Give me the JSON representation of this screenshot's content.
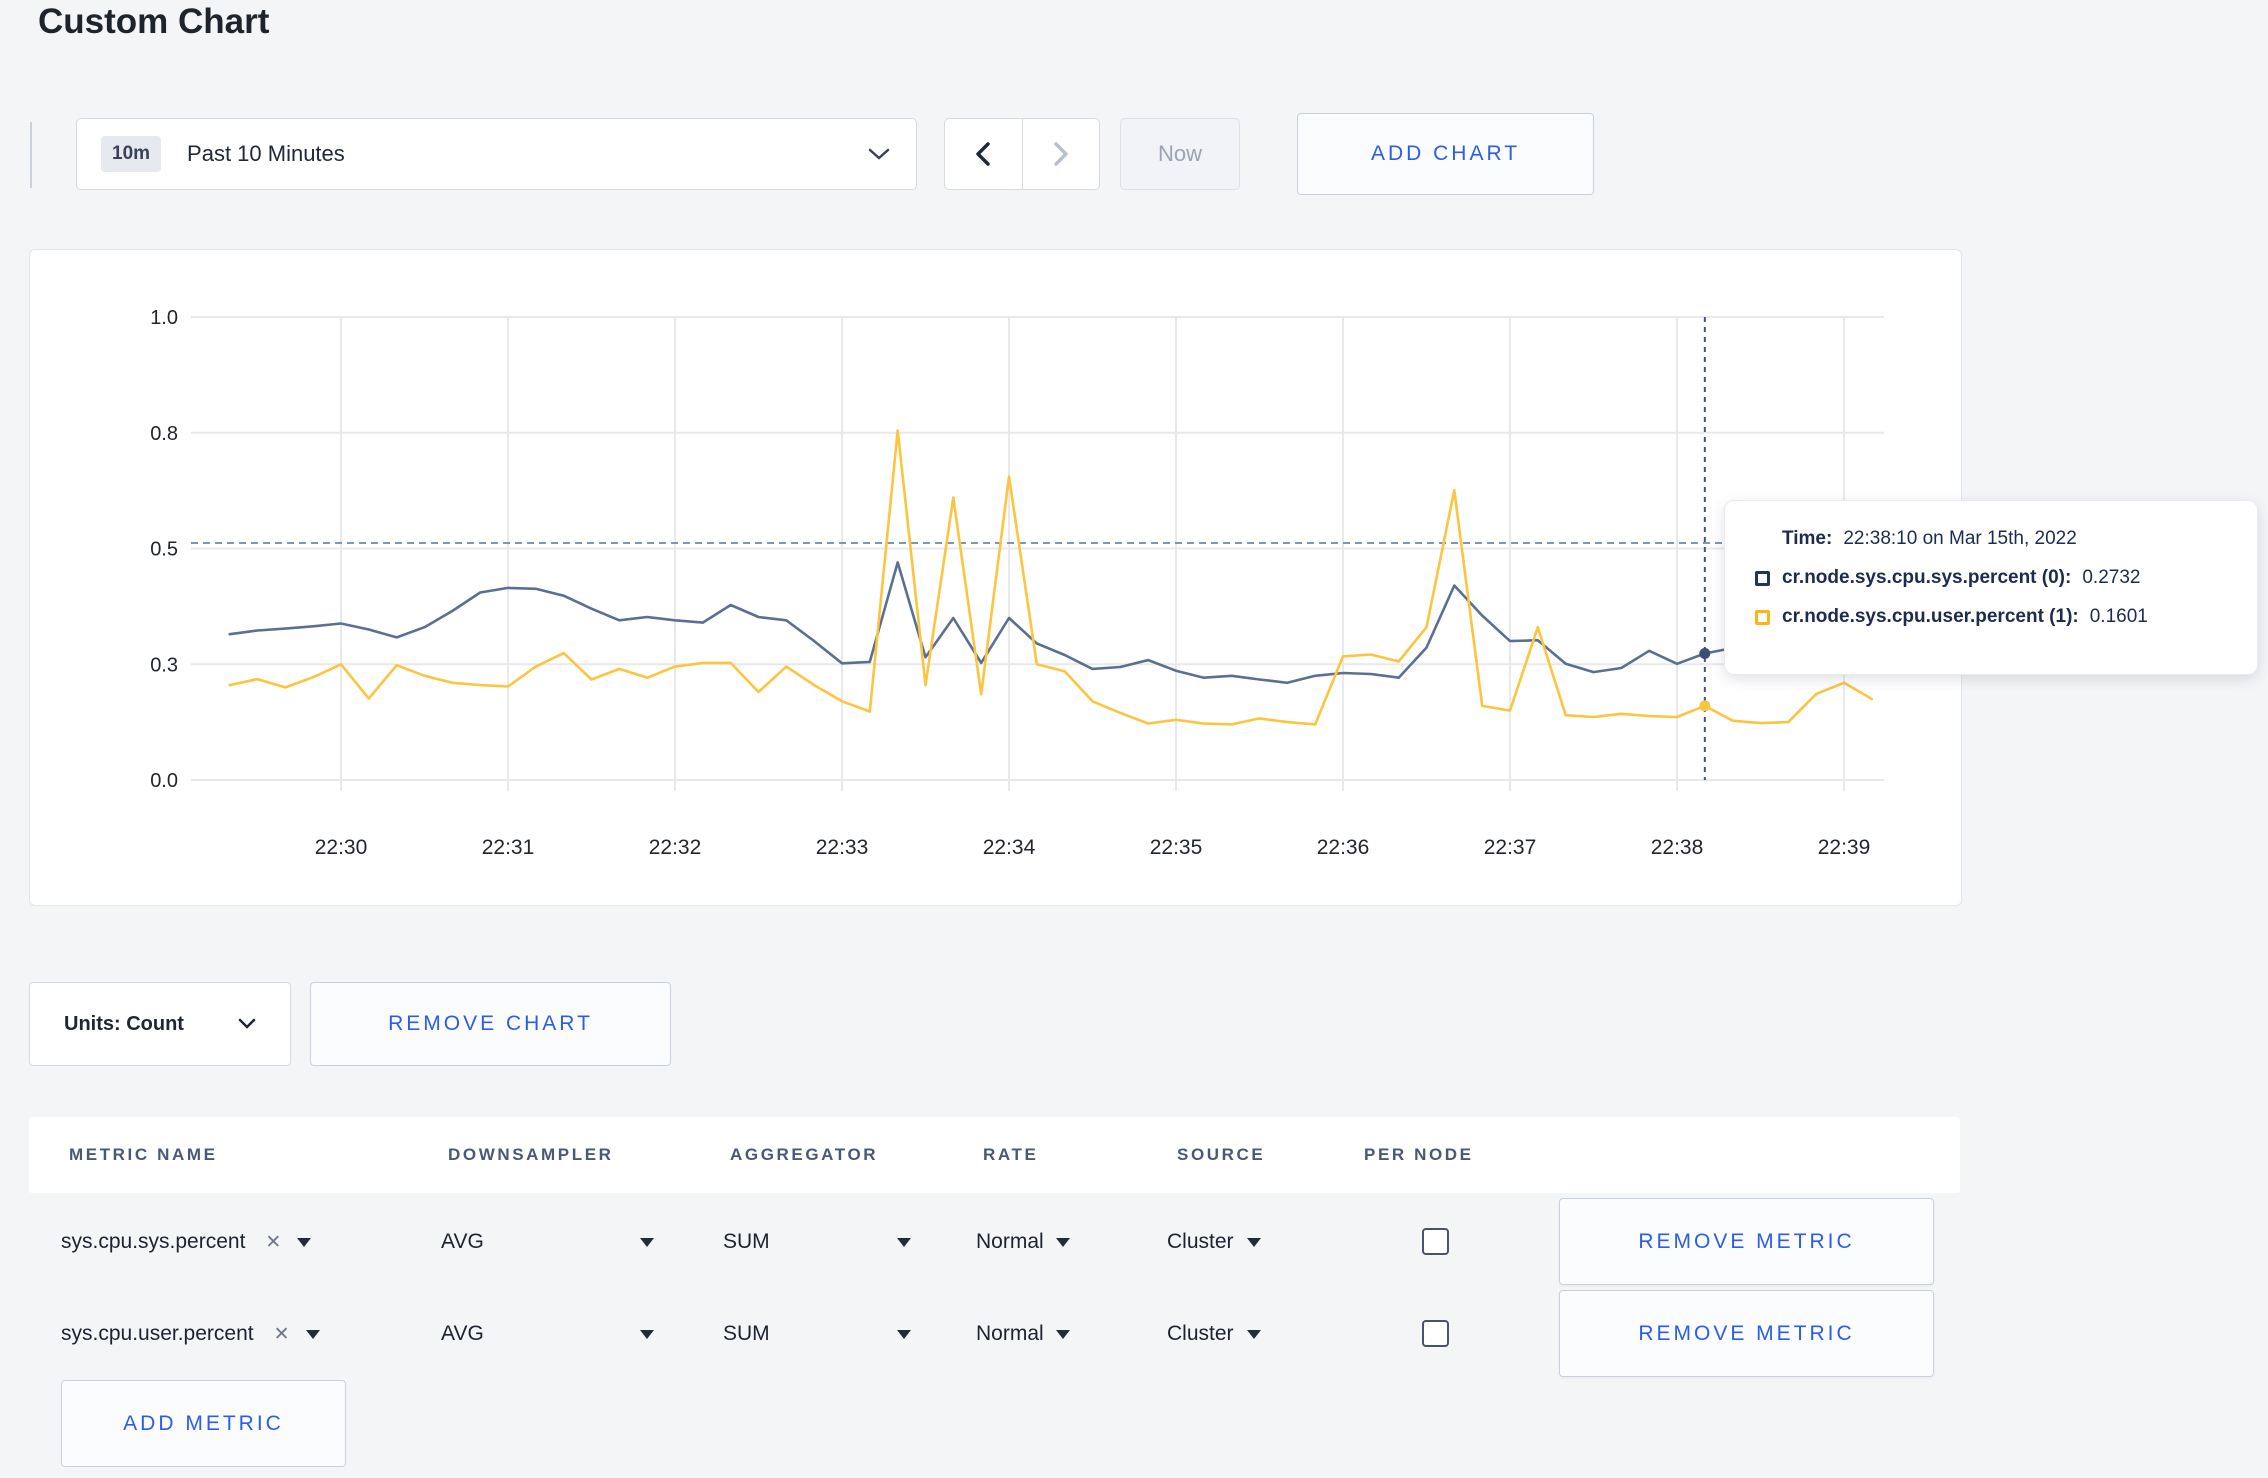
{
  "page": {
    "title": "Custom Chart",
    "background": "#f4f5f7"
  },
  "toolbar": {
    "time_window_badge": "10m",
    "time_window_label": "Past 10 Minutes",
    "prev_icon": "chevron-left",
    "next_icon": "chevron-right",
    "now_label": "Now",
    "add_chart_label": "ADD CHART"
  },
  "chart_controls": {
    "units_label": "Units: Count",
    "remove_chart_label": "REMOVE CHART"
  },
  "tooltip": {
    "time_label": "Time:",
    "time_value": "22:38:10 on Mar 15th, 2022",
    "series": [
      {
        "name": "cr.node.sys.cpu.sys.percent (0):",
        "value": "0.2732",
        "color": "#24335b"
      },
      {
        "name": "cr.node.sys.cpu.user.percent (1):",
        "value": "0.1601",
        "color": "#fdb515"
      }
    ]
  },
  "chart_data": {
    "type": "line",
    "title": "",
    "xlabel": "",
    "ylabel": "",
    "grid": true,
    "legend_position": "tooltip-only",
    "ylim": [
      0,
      1.045
    ],
    "y_ticks": [
      {
        "label": "0.0",
        "value": 0
      },
      {
        "label": "0.3",
        "value": 0.25
      },
      {
        "label": "0.5",
        "value": 0.5
      },
      {
        "label": "0.8",
        "value": 0.75
      },
      {
        "label": "1.0",
        "value": 1.0
      }
    ],
    "x_ticks": [
      {
        "label": "22:30",
        "seconds": 0
      },
      {
        "label": "22:31",
        "seconds": 60
      },
      {
        "label": "22:32",
        "seconds": 120
      },
      {
        "label": "22:33",
        "seconds": 180
      },
      {
        "label": "22:34",
        "seconds": 240
      },
      {
        "label": "22:35",
        "seconds": 300
      },
      {
        "label": "22:36",
        "seconds": 360
      },
      {
        "label": "22:37",
        "seconds": 420
      },
      {
        "label": "22:38",
        "seconds": 480
      },
      {
        "label": "22:39",
        "seconds": 540
      }
    ],
    "x_start_seconds": -40,
    "x_step_seconds": 10,
    "threshold_dashed_line_value": 0.512,
    "crosshair": {
      "time_label": "22:38:10",
      "seconds": 490,
      "points": [
        {
          "series": 0,
          "value": 0.2732
        },
        {
          "series": 1,
          "value": 0.1601
        }
      ]
    },
    "series": [
      {
        "name": "cr.node.sys.cpu.sys.percent (0)",
        "color": "#5b6f92",
        "values": [
          0.315,
          0.323,
          0.327,
          0.332,
          0.338,
          0.325,
          0.308,
          0.33,
          0.365,
          0.405,
          0.415,
          0.413,
          0.398,
          0.37,
          0.345,
          0.352,
          0.345,
          0.34,
          0.378,
          0.352,
          0.345,
          0.3,
          0.252,
          0.255,
          0.47,
          0.265,
          0.35,
          0.253,
          0.35,
          0.295,
          0.27,
          0.24,
          0.244,
          0.259,
          0.236,
          0.221,
          0.225,
          0.217,
          0.21,
          0.225,
          0.231,
          0.229,
          0.221,
          0.286,
          0.42,
          0.355,
          0.3,
          0.302,
          0.251,
          0.233,
          0.242,
          0.279,
          0.251,
          0.2732,
          0.285,
          0.29,
          0.285,
          0.295,
          0.3,
          0.295
        ]
      },
      {
        "name": "cr.node.sys.cpu.user.percent (1)",
        "color": "#fdc440",
        "values": [
          0.205,
          0.218,
          0.2,
          0.222,
          0.25,
          0.176,
          0.248,
          0.225,
          0.21,
          0.205,
          0.202,
          0.245,
          0.274,
          0.217,
          0.24,
          0.221,
          0.245,
          0.253,
          0.253,
          0.19,
          0.245,
          0.205,
          0.17,
          0.148,
          0.755,
          0.205,
          0.61,
          0.185,
          0.655,
          0.25,
          0.235,
          0.17,
          0.145,
          0.122,
          0.13,
          0.122,
          0.12,
          0.133,
          0.125,
          0.12,
          0.267,
          0.271,
          0.256,
          0.33,
          0.626,
          0.16,
          0.15,
          0.33,
          0.14,
          0.136,
          0.143,
          0.138,
          0.136,
          0.1601,
          0.128,
          0.123,
          0.125,
          0.186,
          0.21,
          0.175
        ]
      }
    ]
  },
  "metrics_table": {
    "columns": [
      "METRIC NAME",
      "DOWNSAMPLER",
      "AGGREGATOR",
      "RATE",
      "SOURCE",
      "PER NODE"
    ],
    "rows": [
      {
        "metric": "sys.cpu.sys.percent",
        "downsampler": "AVG",
        "aggregator": "SUM",
        "rate": "Normal",
        "source": "Cluster",
        "per_node_checked": false,
        "remove_label": "REMOVE METRIC"
      },
      {
        "metric": "sys.cpu.user.percent",
        "downsampler": "AVG",
        "aggregator": "SUM",
        "rate": "Normal",
        "source": "Cluster",
        "per_node_checked": false,
        "remove_label": "REMOVE METRIC"
      }
    ],
    "add_metric_label": "ADD METRIC"
  }
}
